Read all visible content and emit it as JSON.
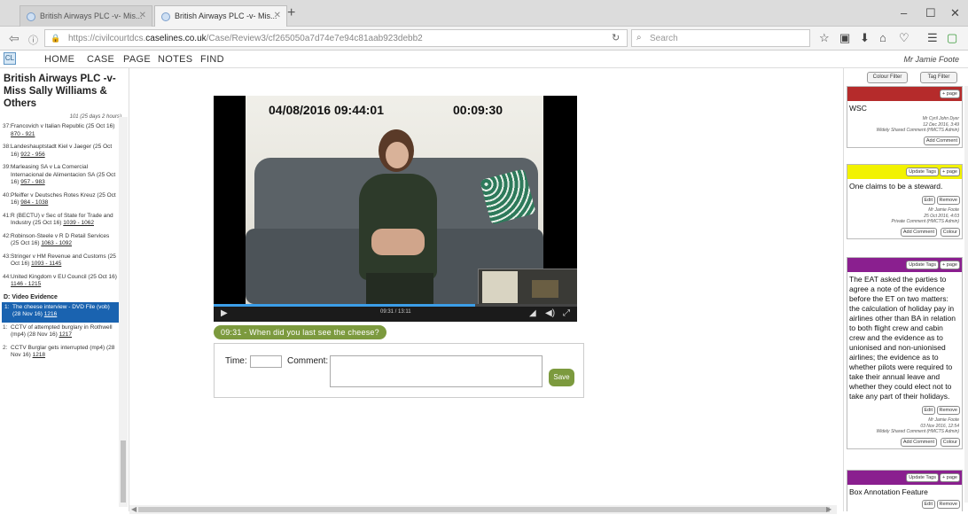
{
  "browser": {
    "tabs": [
      {
        "label": "British Airways PLC -v- Mis..."
      },
      {
        "label": "British Airways PLC -v- Mis..."
      }
    ],
    "new_tab": "+",
    "url_prefix": "https://civilcourtdcs.",
    "url_host": "caselines.co.uk",
    "url_path": "/Case/Review3/cf265050a7d74e7e94c81aab923debb2",
    "search_placeholder": "Search",
    "window_controls": [
      "–",
      "☐",
      "✕"
    ]
  },
  "appmenu": {
    "logo": "CL",
    "items": [
      "HOME",
      "CASE",
      "PAGE",
      "NOTES",
      "FIND"
    ],
    "user": "Mr Jamie Foote"
  },
  "left_panel": {
    "case_title": "British Airways PLC -v- Miss Sally Williams & Others",
    "hours": "101 (25 days 2 hours)",
    "items": [
      {
        "num": "37:",
        "text": "Francovich v Italian Republic (25 Oct 16)",
        "pages": "870 - 921"
      },
      {
        "num": "38:",
        "text": "Landeshauptstadt Kiel v Jaeger (25 Oct 16)",
        "pages": "922 - 956"
      },
      {
        "num": "39:",
        "text": "Marleasing SA v La Comercial Internacional de Alimentacion SA (25 Oct 16)",
        "pages": "957 - 983"
      },
      {
        "num": "40:",
        "text": "Pfeiffer v Deutsches Rotes Kreuz (25 Oct 16)",
        "pages": "984 - 1038"
      },
      {
        "num": "41:",
        "text": "R (BECTU) v Sec of State for Trade and Industry (25 Oct 16)",
        "pages": "1039 - 1062"
      },
      {
        "num": "42:",
        "text": "Robinson-Steele v R D Retail Services (25 Oct 16)",
        "pages": "1063 - 1092"
      },
      {
        "num": "43:",
        "text": "Stringer v HM Revenue and Customs (25 Oct 16)",
        "pages": "1093 - 1145"
      },
      {
        "num": "44:",
        "text": "United Kingdom v EU Council (25 Oct 16)",
        "pages": "1146 - 1215"
      }
    ],
    "section": "D:  Video Evidence",
    "video_items": [
      {
        "num": "1:",
        "text": "The cheese interview - DVD File (vob) (28 Nov 16)",
        "pages": "1216",
        "selected": true
      },
      {
        "num": "1:",
        "text": "CCTV of attempted burglary in Rothwell (mp4) (28 Nov 16)",
        "pages": "1217",
        "selected": false
      },
      {
        "num": "2:",
        "text": "CCTV Burglar gets interrupted (mp4) (28 Nov 16)",
        "pages": "1218",
        "selected": false
      }
    ]
  },
  "video": {
    "date_overlay": "04/08/2016 09:44:01",
    "time_overlay": "00:09:30",
    "time_display": "09:31 / 13:11",
    "progress": 0.72,
    "subtitle": "09:31 - When did you last see the cheese?"
  },
  "comment_form": {
    "time_label": "Time:",
    "comment_label": "Comment:",
    "save_label": "Save"
  },
  "right_panel": {
    "colour_filter": "Colour Filter",
    "tag_filter": "Tag Filter",
    "cards": [
      {
        "color": "#b52b2b",
        "text": "WSC",
        "meta": [
          "Mr Cyril John Dyer",
          "12 Dec 2016, 3:49",
          "Widely Shared Comment (HMCTS Admin)"
        ],
        "buttons": [
          "Add Comment"
        ],
        "head_buttons": [
          "+ page"
        ]
      },
      {
        "color": "#f2f200",
        "text": "One claims to be a steward.",
        "meta": [
          "Mr Jamie Foote",
          "25 Oct 2016, 4:03",
          "Private Comment (HMCTS Admin)"
        ],
        "edit_buttons": [
          "Edit",
          "Remove"
        ],
        "buttons": [
          "Add Comment",
          "Colour"
        ],
        "head_buttons": [
          "Update Tags",
          "+ page"
        ]
      },
      {
        "color": "#8a1f8f",
        "text": "The EAT asked the parties to agree a note of the evidence before the ET on two matters: the calculation of holiday pay in airlines other than BA in relation to both flight crew and cabin crew and the evidence as to unionised and non-unionised airlines; the evidence as to whether pilots were required to take their annual leave and whether they could elect not to take any part of their holidays.",
        "meta": [
          "Mr Jamie Foote",
          "03 Nov 2016, 12:54",
          "Widely Shared Comment (HMCTS Admin)"
        ],
        "edit_buttons": [
          "Edit",
          "Remove"
        ],
        "buttons": [
          "Add Comment",
          "Colour"
        ],
        "head_buttons": [
          "Update Tags",
          "+ page"
        ]
      },
      {
        "color": "#8a1f8f",
        "text": "Box Annotation Feature",
        "meta": [],
        "edit_buttons": [
          "Edit",
          "Remove"
        ],
        "buttons": [],
        "head_buttons": [
          "Update Tags",
          "+ page"
        ]
      }
    ]
  }
}
